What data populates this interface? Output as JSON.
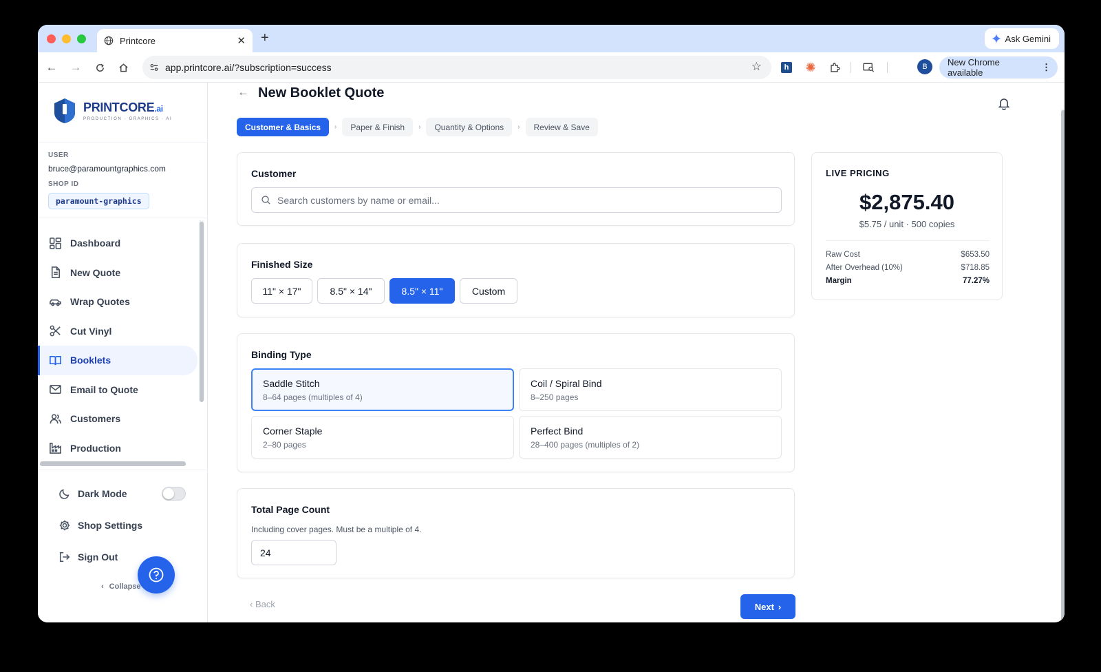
{
  "browser": {
    "tab_title": "Printcore",
    "url": "app.printcore.ai/?subscription=success",
    "gemini_label": "Ask Gemini",
    "profile_initial": "B",
    "update_label": "New Chrome available"
  },
  "brand": {
    "name": "PRINTCORE",
    "suffix": ".ai",
    "tagline": "PRODUCTION · GRAPHICS · AI"
  },
  "sidebar": {
    "user_label": "USER",
    "user_email": "bruce@paramountgraphics.com",
    "shop_label": "SHOP ID",
    "shop_id": "paramount-graphics",
    "items": [
      {
        "label": "Dashboard",
        "icon": "dashboard-icon"
      },
      {
        "label": "New Quote",
        "icon": "document-icon"
      },
      {
        "label": "Wrap Quotes",
        "icon": "car-icon"
      },
      {
        "label": "Cut Vinyl",
        "icon": "scissors-icon"
      },
      {
        "label": "Booklets",
        "icon": "book-open-icon",
        "active": true
      },
      {
        "label": "Email to Quote",
        "icon": "mail-icon"
      },
      {
        "label": "Customers",
        "icon": "users-icon"
      },
      {
        "label": "Production",
        "icon": "factory-icon"
      }
    ],
    "dark_mode_label": "Dark Mode",
    "dark_mode_on": false,
    "settings_label": "Shop Settings",
    "sign_out_label": "Sign Out",
    "collapse_label": "Collapse"
  },
  "page": {
    "title": "New Booklet Quote",
    "steps": [
      "Customer & Basics",
      "Paper & Finish",
      "Quantity & Options",
      "Review & Save"
    ],
    "active_step": 0
  },
  "customer": {
    "title": "Customer",
    "search_placeholder": "Search customers by name or email..."
  },
  "finished_size": {
    "title": "Finished Size",
    "options": [
      "11\" × 17\"",
      "8.5\" × 14\"",
      "8.5\" × 11\"",
      "Custom"
    ],
    "selected": "8.5\" × 11\""
  },
  "binding": {
    "title": "Binding Type",
    "options": [
      {
        "name": "Saddle Stitch",
        "desc": "8–64 pages (multiples of 4)"
      },
      {
        "name": "Coil / Spiral Bind",
        "desc": "8–250 pages"
      },
      {
        "name": "Corner Staple",
        "desc": "2–80 pages"
      },
      {
        "name": "Perfect Bind",
        "desc": "28–400 pages (multiples of 2)"
      }
    ],
    "selected": "Saddle Stitch"
  },
  "page_count": {
    "title": "Total Page Count",
    "hint": "Including cover pages. Must be a multiple of 4.",
    "value": "24"
  },
  "footer_nav": {
    "back_label": "Back",
    "next_label": "Next"
  },
  "pricing": {
    "label": "LIVE PRICING",
    "total": "$2,875.40",
    "unit_line": "$5.75 / unit · 500 copies",
    "rows": [
      {
        "label": "Raw Cost",
        "value": "$653.50"
      },
      {
        "label": "After Overhead (10%)",
        "value": "$718.85"
      },
      {
        "label": "Margin",
        "value": "77.27%"
      }
    ]
  },
  "colors": {
    "accent": "#2563eb",
    "brand_dark": "#1e3a8a",
    "tabstrip": "#d3e3fd"
  }
}
